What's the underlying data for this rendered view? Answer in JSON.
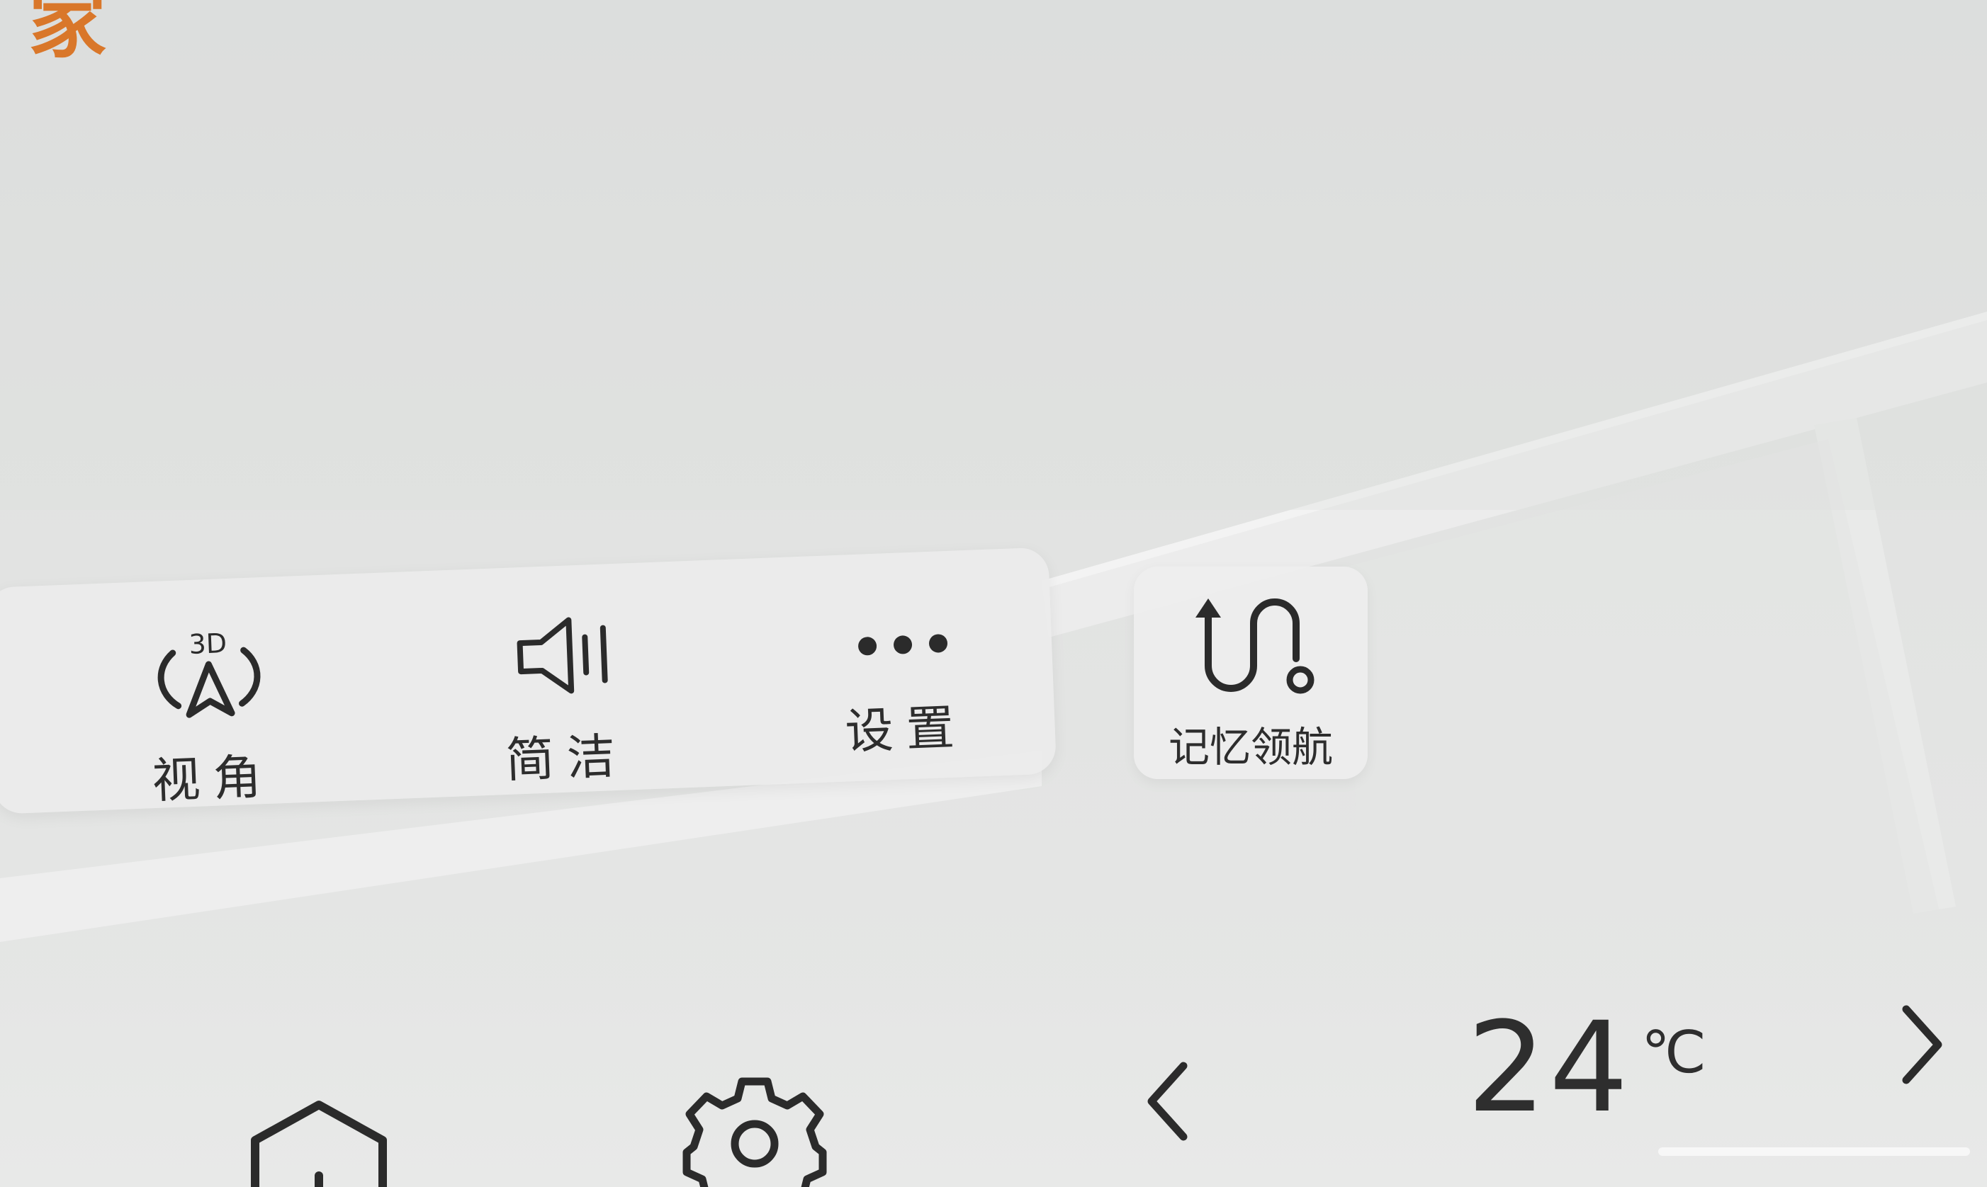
{
  "brand": {
    "glyph": "家"
  },
  "quick_panel": {
    "items": [
      {
        "id": "view",
        "label": "视角",
        "icon": "3d-view-arrow-icon",
        "icon_badge": "3D"
      },
      {
        "id": "concise",
        "label": "简洁",
        "icon": "speaker-icon"
      },
      {
        "id": "settings",
        "label": "设置",
        "icon": "more-dots-icon"
      }
    ]
  },
  "memory_nav": {
    "label": "记忆领航",
    "icon": "memory-route-icon"
  },
  "dock": {
    "home_icon": "home-icon",
    "settings_icon": "gear-icon",
    "prev_icon": "chevron-left-icon",
    "next_icon": "chevron-right-icon",
    "temperature": {
      "value": "24",
      "unit": "℃"
    }
  },
  "colors": {
    "brand": "#d9772a",
    "panel": "#ececec",
    "text": "#2b2b2b",
    "map_bg": "#e1e2e1"
  }
}
